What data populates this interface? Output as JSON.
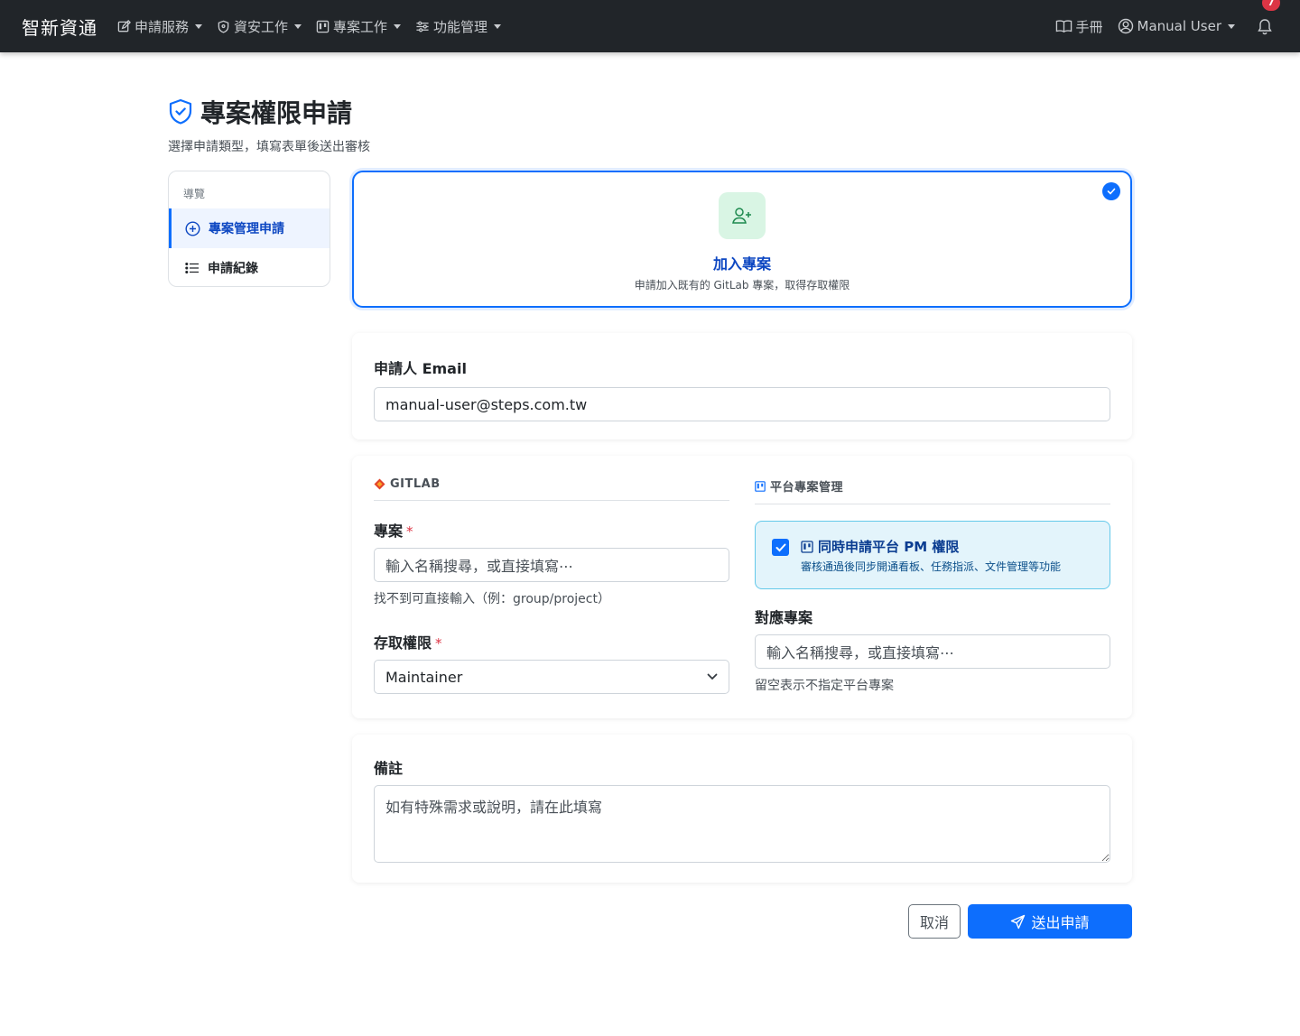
{
  "navbar": {
    "brand": "智新資通",
    "menus": [
      {
        "label": "申請服務",
        "icon": "edit-icon"
      },
      {
        "label": "資安工作",
        "icon": "shield-icon"
      },
      {
        "label": "專案工作",
        "icon": "kanban-icon"
      },
      {
        "label": "功能管理",
        "icon": "sliders-icon"
      }
    ],
    "manual_label": "手冊",
    "user_label": "Manual User",
    "notification_count": "7"
  },
  "header": {
    "title": "專案權限申請",
    "subtitle": "選擇申請類型，填寫表單後送出審核"
  },
  "sidebar": {
    "section_label": "導覽",
    "items": [
      {
        "label": "專案管理申請",
        "icon": "plus-circle-icon",
        "active": true
      },
      {
        "label": "申請紀錄",
        "icon": "list-icon",
        "active": false
      }
    ]
  },
  "request_type": {
    "title": "加入專案",
    "description": "申請加入既有的 GitLab 專案，取得存取權限",
    "selected": true
  },
  "applicant": {
    "label": "申請人 Email",
    "value": "manual-user@steps.com.tw"
  },
  "gitlab": {
    "section_title": "GITLAB",
    "project_label": "專案",
    "project_required": "*",
    "project_placeholder": "輸入名稱搜尋，或直接填寫⋯",
    "project_help": "找不到可直接輸入（例：group/project）",
    "access_label": "存取權限",
    "access_required": "*",
    "access_value": "Maintainer"
  },
  "platform": {
    "section_title": "平台專案管理",
    "pm_checkbox_label": "同時申請平台 PM 權限",
    "pm_checkbox_checked": true,
    "pm_checkbox_desc": "審核通過後同步開通看板、任務指派、文件管理等功能",
    "mapped_label": "對應專案",
    "mapped_placeholder": "輸入名稱搜尋，或直接填寫⋯",
    "mapped_help": "留空表示不指定平台專案"
  },
  "notes": {
    "label": "備註",
    "placeholder": "如有特殊需求或說明，請在此填寫"
  },
  "actions": {
    "cancel_label": "取消",
    "submit_label": "送出申請"
  },
  "colors": {
    "primary": "#0d6efd",
    "navbar": "#212529",
    "danger": "#dc3545",
    "info_bg": "#e3f4fb"
  }
}
